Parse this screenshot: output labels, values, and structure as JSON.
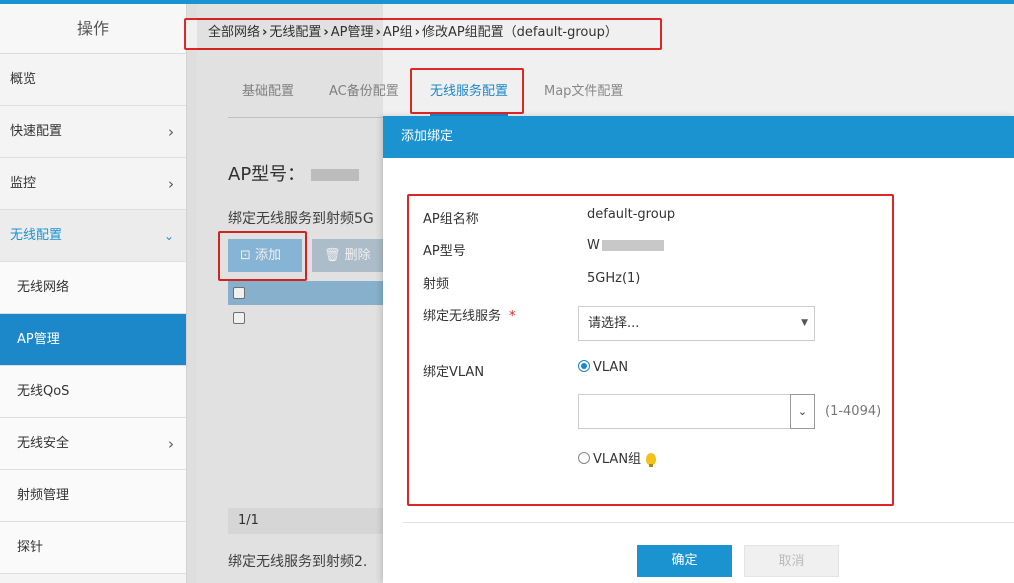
{
  "sidebar": {
    "header": "操作",
    "items": [
      {
        "label": "概览"
      },
      {
        "label": "快速配置"
      },
      {
        "label": "监控"
      },
      {
        "label": "无线配置"
      },
      {
        "label": "无线网络"
      },
      {
        "label": "AP管理"
      },
      {
        "label": "无线QoS"
      },
      {
        "label": "无线安全"
      },
      {
        "label": "射频管理"
      },
      {
        "label": "探针"
      }
    ]
  },
  "breadcrumb": [
    "全部网络",
    "无线配置",
    "AP管理",
    "AP组",
    "修改AP组配置（default-group）"
  ],
  "tabs": [
    "基础配置",
    "AC备份配置",
    "无线服务配置",
    "Map文件配置"
  ],
  "background": {
    "ap_model_label": "AP型号：",
    "bind_title_1": "绑定无线服务到射频5G",
    "bind_title_2": "绑定无线服务到射频2.",
    "add_button": "添加",
    "delete_button": "删除",
    "pager": "1/1"
  },
  "modal": {
    "title": "添加绑定",
    "fields": {
      "group_name_label": "AP组名称",
      "group_name_value": "default-group",
      "ap_model_label": "AP型号",
      "ap_model_value": "W",
      "radio_label": "射频",
      "radio_value": "5GHz(1)",
      "service_label": "绑定无线服务",
      "service_required": "*",
      "service_placeholder": "请选择...",
      "vlan_label": "绑定VLAN",
      "vlan_option": "VLAN",
      "vlan_range": "(1-4094)",
      "vlan_group_option": "VLAN组"
    },
    "ok_button": "确定",
    "cancel_button": "取消"
  },
  "colors": {
    "accent": "#1c93d1",
    "active_menu": "#1c87c9",
    "highlight_box": "#e02525"
  }
}
